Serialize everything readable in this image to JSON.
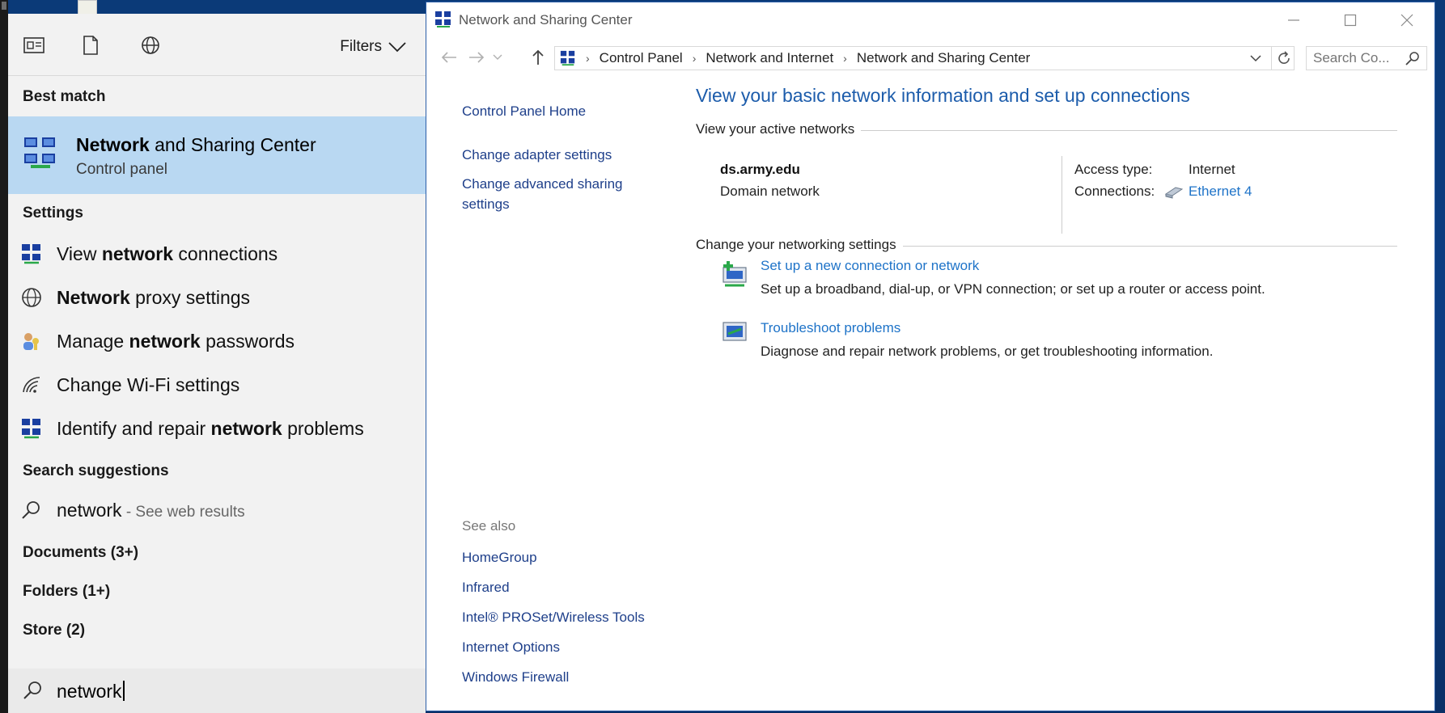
{
  "search_panel": {
    "filters_label": "Filters",
    "best_match_heading": "Best match",
    "best_match": {
      "title_bold": "Network",
      "title_rest": " and Sharing Center",
      "subtitle": "Control panel"
    },
    "settings_heading": "Settings",
    "settings": [
      {
        "pre": "View ",
        "bold": "network",
        "post": " connections"
      },
      {
        "pre": "",
        "bold": "Network",
        "post": " proxy settings"
      },
      {
        "pre": "Manage ",
        "bold": "network",
        "post": " passwords"
      },
      {
        "pre": "Change Wi-Fi settings",
        "bold": "",
        "post": ""
      },
      {
        "pre": "Identify and repair ",
        "bold": "network",
        "post": " problems"
      }
    ],
    "suggestions_heading": "Search suggestions",
    "suggestion": {
      "term": "network",
      "suffix": " - See web results"
    },
    "documents": "Documents (3+)",
    "folders": "Folders (1+)",
    "store": "Store (2)",
    "query": "network"
  },
  "window": {
    "title": "Network and Sharing Center",
    "breadcrumb": [
      "Control Panel",
      "Network and Internet",
      "Network and Sharing Center"
    ],
    "search_placeholder": "Search Co...",
    "left_pane": {
      "links": [
        "Control Panel Home",
        "Change adapter settings",
        "Change advanced sharing settings"
      ],
      "see_also_heading": "See also",
      "see_also": [
        "HomeGroup",
        "Infrared",
        "Intel® PROSet/Wireless Tools",
        "Internet Options",
        "Windows Firewall"
      ]
    },
    "main": {
      "title": "View your basic network information and set up connections",
      "active_networks_label": "View your active networks",
      "network_name": "ds.army.edu",
      "network_type": "Domain network",
      "access_type_label": "Access type:",
      "access_type_value": "Internet",
      "connections_label": "Connections:",
      "connections_value": "Ethernet 4",
      "change_settings_label": "Change your networking settings",
      "tasks": [
        {
          "link": "Set up a new connection or network",
          "desc": "Set up a broadband, dial-up, or VPN connection; or set up a router or access point."
        },
        {
          "link": "Troubleshoot problems",
          "desc": "Diagnose and repair network problems, or get troubleshooting information."
        }
      ]
    }
  },
  "colors": {
    "accent_blue": "#1c5cab",
    "link_blue": "#1e73c8",
    "best_match_bg": "#b9d8f2",
    "panel_bg": "#f2f2f2"
  }
}
